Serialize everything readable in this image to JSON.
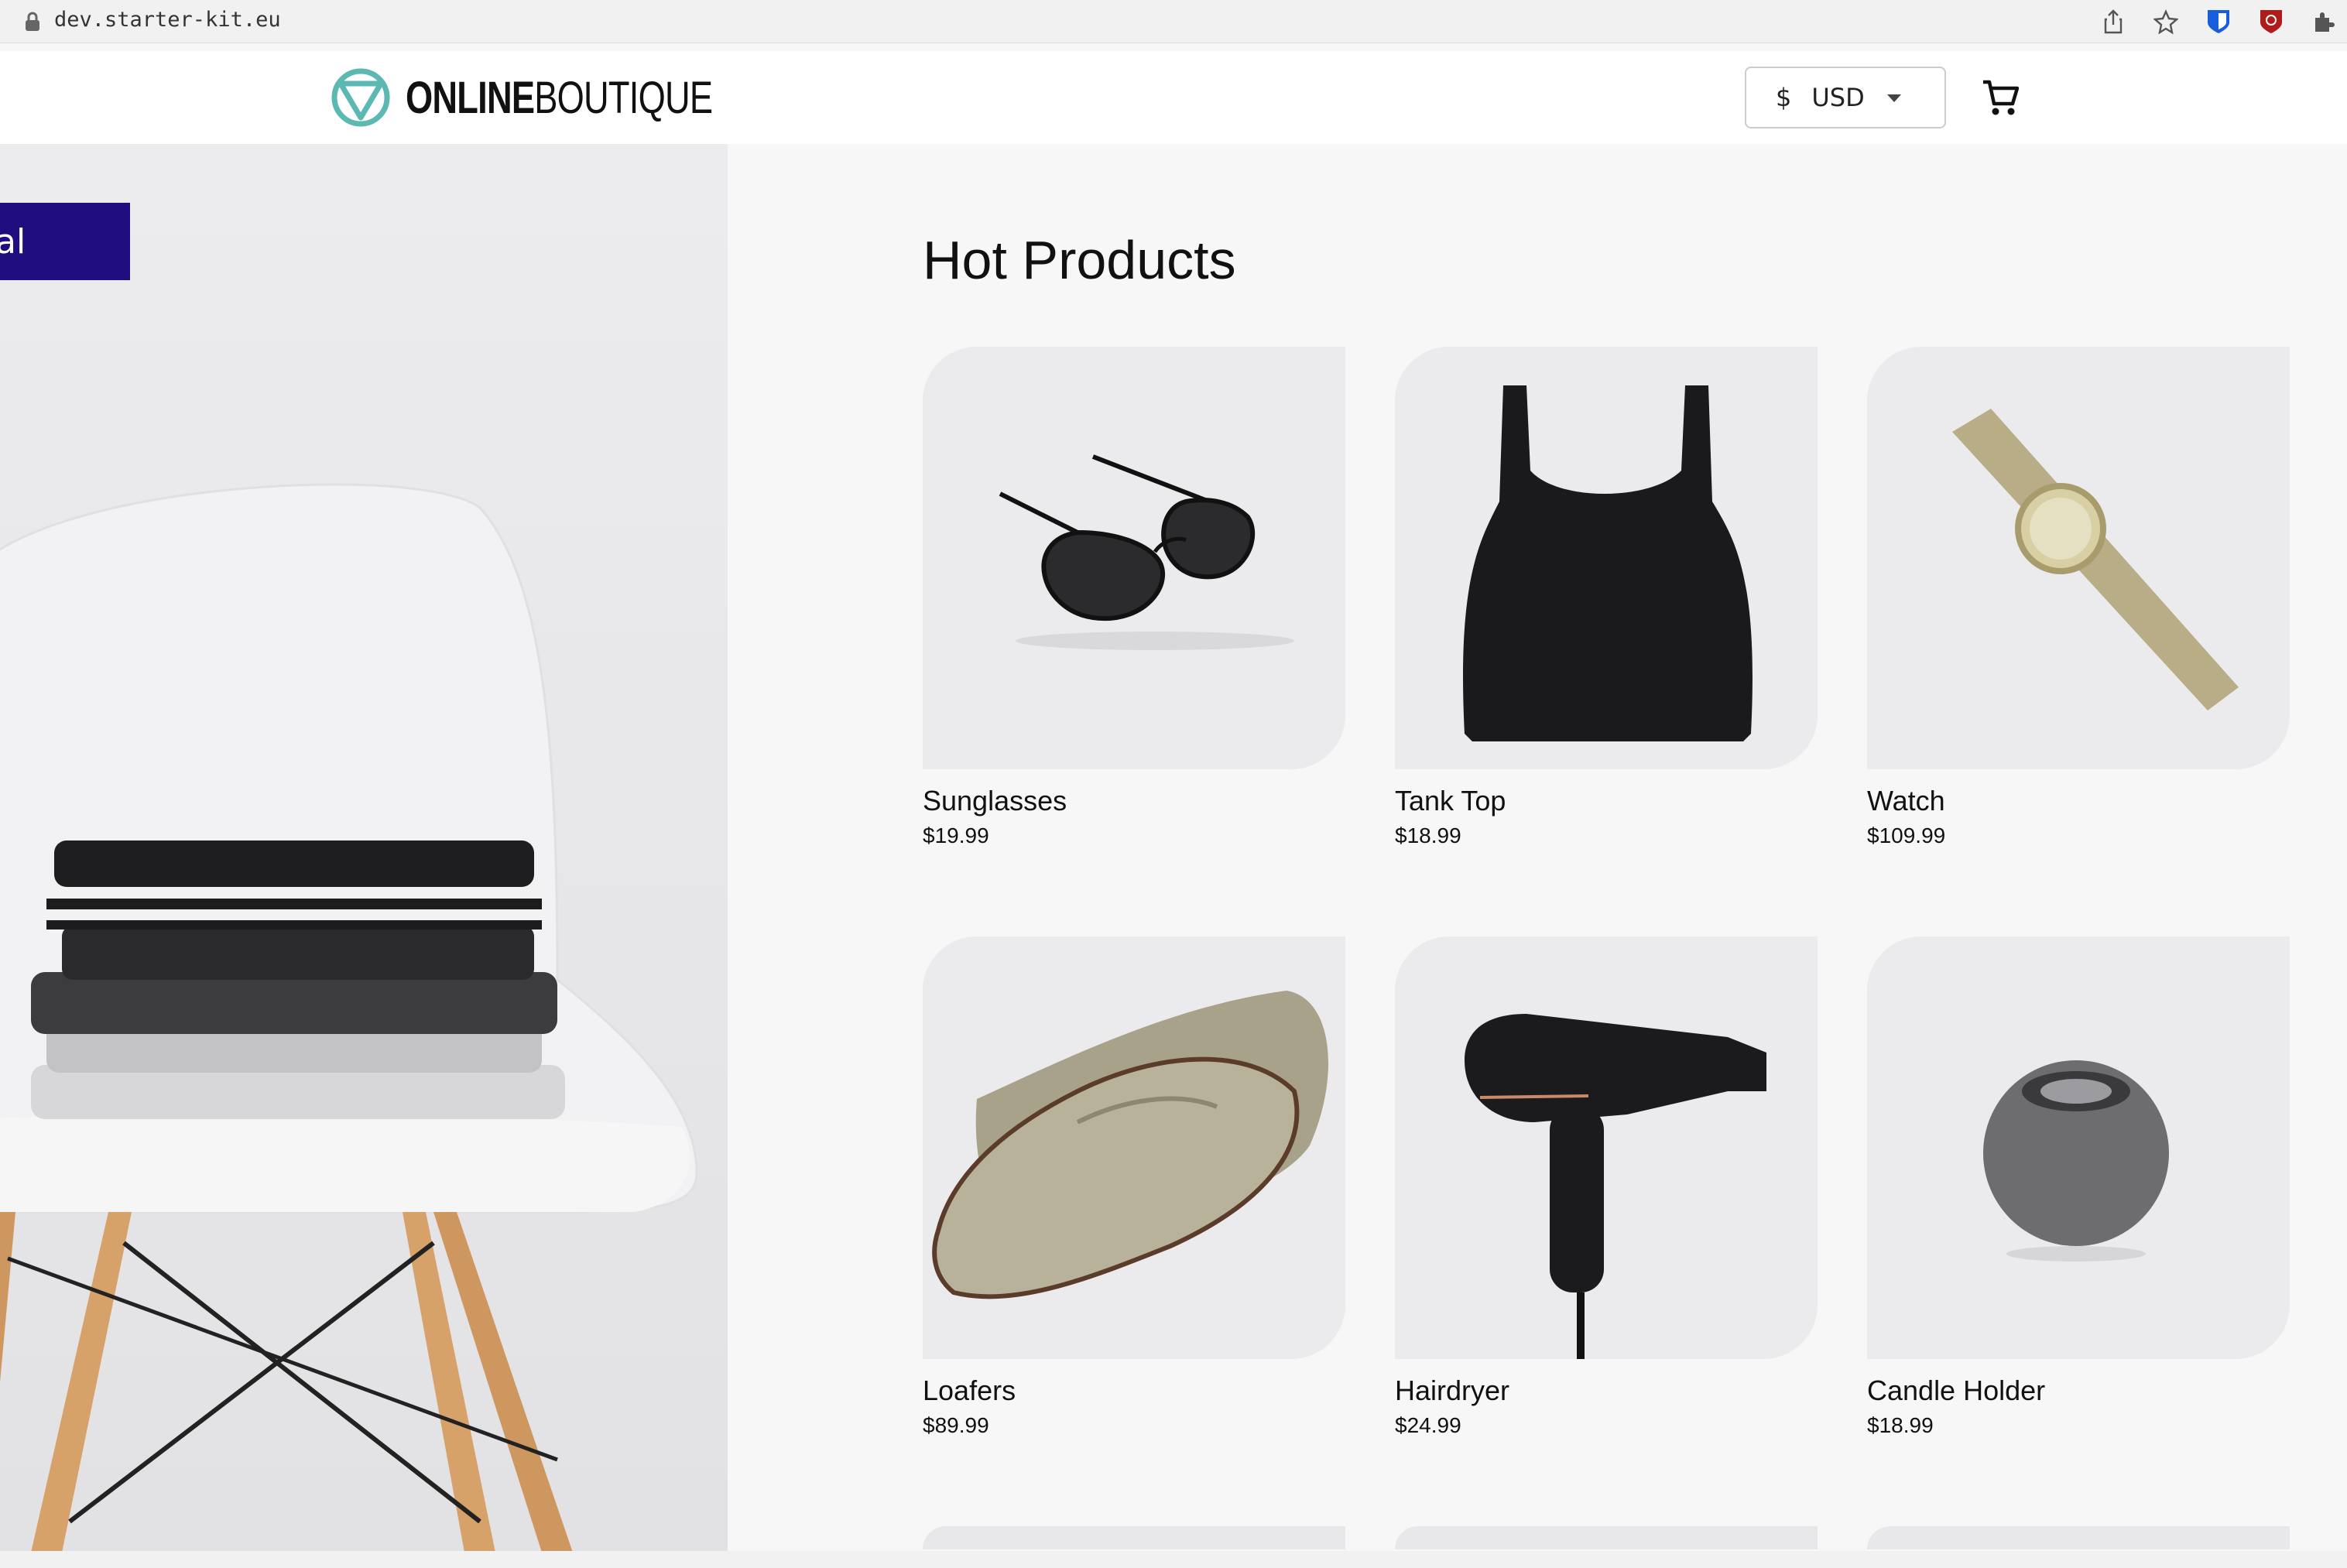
{
  "browser": {
    "url": "dev.starter-kit.eu"
  },
  "header": {
    "logo_bold": "ONLINE",
    "logo_light": "BOUTIQUE",
    "currency_symbol": "$",
    "currency_code": "USD"
  },
  "hero": {
    "badge_text": "al"
  },
  "main": {
    "section_title": "Hot Products",
    "products": [
      {
        "name": "Sunglasses",
        "price": "$19.99"
      },
      {
        "name": "Tank Top",
        "price": "$18.99"
      },
      {
        "name": "Watch",
        "price": "$109.99"
      },
      {
        "name": "Loafers",
        "price": "$89.99"
      },
      {
        "name": "Hairdryer",
        "price": "$24.99"
      },
      {
        "name": "Candle Holder",
        "price": "$18.99"
      }
    ]
  },
  "colors": {
    "accent": "#200d80",
    "logo_teal": "#5cb8b2"
  }
}
